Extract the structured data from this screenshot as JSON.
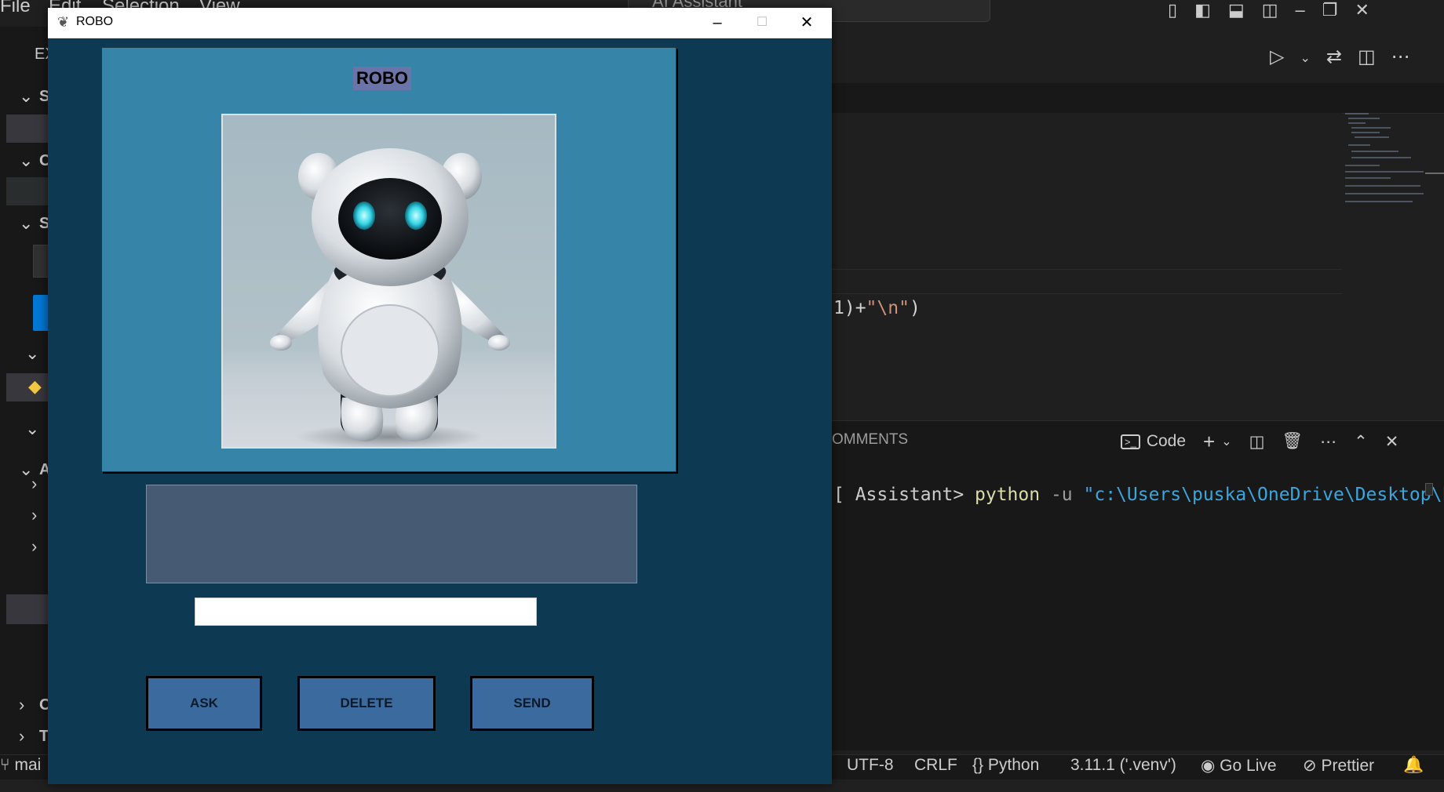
{
  "vscode": {
    "menu": [
      "File",
      "Edit",
      "Selection",
      "View",
      "..."
    ],
    "search_text": "AI Assistant",
    "sidebar_rows": [
      "EX",
      "SC",
      "O",
      "SC",
      "AI",
      "O",
      "TI"
    ],
    "panel_tab": "OMMENTS",
    "terminal_profile": "Code",
    "code_text": "1)+",
    "code_string": "\"\\n\"",
    "code_close": ")",
    "terminal": {
      "prompt": "[ Assistant> ",
      "command": "python",
      "flag": " -u ",
      "path": "\"c:\\Users\\puska\\OneDrive\\Desktop\\Li"
    },
    "status": {
      "branch": "mai",
      "encoding": "UTF-8",
      "eol": "CRLF",
      "language": "Python",
      "interpreter": "3.11.1 ('.venv')",
      "golive": "Go Live",
      "prettier": "Prettier"
    }
  },
  "robo": {
    "window_title": "ROBO",
    "header_label": "ROBO",
    "entry_value": "",
    "buttons": {
      "ask": "ASK",
      "delete": "DELETE",
      "send": "SEND"
    }
  },
  "colors": {
    "window_bg": "#0d3a52",
    "frame_bg": "#3684a8",
    "label_bg": "#6a74a8",
    "display_bg": "#475a73",
    "button_bg": "#3b6a9f"
  }
}
